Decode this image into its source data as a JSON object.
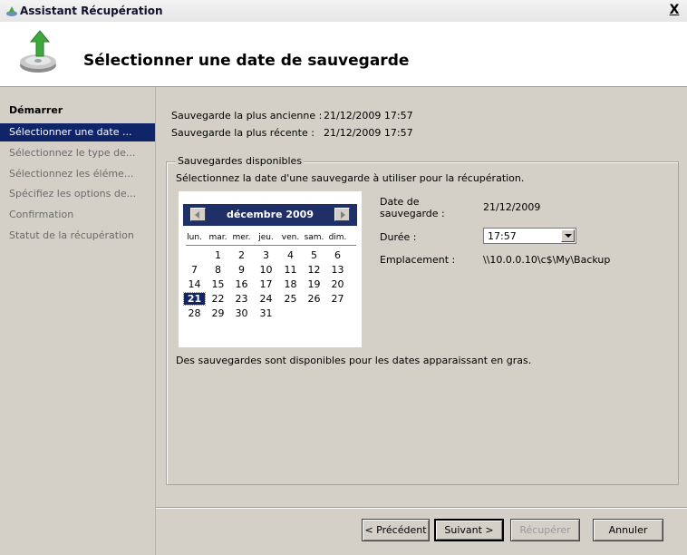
{
  "window": {
    "title": "Assistant Récupération",
    "close_glyph": "X"
  },
  "header": {
    "title": "Sélectionner une date de sauvegarde",
    "icon": "backup-restore-icon"
  },
  "sidebar": {
    "items": [
      {
        "label": "Démarrer",
        "state": "done"
      },
      {
        "label": "Sélectionner une date ...",
        "state": "active"
      },
      {
        "label": "Sélectionnez le type de...",
        "state": "pending"
      },
      {
        "label": "Sélectionnez les éléme...",
        "state": "pending"
      },
      {
        "label": "Spécifiez les options de...",
        "state": "pending"
      },
      {
        "label": "Confirmation",
        "state": "pending"
      },
      {
        "label": "Statut de la récupération",
        "state": "pending"
      }
    ]
  },
  "main": {
    "oldest_label": "Sauvegarde la plus ancienne :",
    "oldest_value": "21/12/2009 17:57",
    "newest_label": "Sauvegarde la plus récente :",
    "newest_value": "21/12/2009 17:57",
    "group_title": "Sauvegardes disponibles",
    "instruction": "Sélectionnez la date d'une sauvegarde à utiliser pour la récupération.",
    "note": "Des sauvegardes sont disponibles pour les dates apparaissant en gras."
  },
  "calendar": {
    "month": "décembre 2009",
    "weekdays": [
      "lun.",
      "mar.",
      "mer.",
      "jeu.",
      "ven.",
      "sam.",
      "dim."
    ],
    "weeks": [
      [
        "",
        "1",
        "2",
        "3",
        "4",
        "5",
        "6"
      ],
      [
        "7",
        "8",
        "9",
        "10",
        "11",
        "12",
        "13"
      ],
      [
        "14",
        "15",
        "16",
        "17",
        "18",
        "19",
        "20"
      ],
      [
        "21",
        "22",
        "23",
        "24",
        "25",
        "26",
        "27"
      ],
      [
        "28",
        "29",
        "30",
        "31",
        "",
        "",
        ""
      ]
    ],
    "selected": "21"
  },
  "details": {
    "date_label_1": "Date de",
    "date_label_2": "sauvegarde :",
    "date_value": "21/12/2009",
    "duration_label": "Durée :",
    "duration_value": "17:57",
    "location_label": "Emplacement :",
    "location_value": "\\\\10.0.0.10\\c$\\My\\Backup"
  },
  "footer": {
    "prev": "< Précédent",
    "next": "Suivant >",
    "restore": "Récupérer",
    "cancel": "Annuler"
  },
  "colors": {
    "selection": "#10246a",
    "calendar_header": "#1f2f68",
    "window_bg": "#d4d0c8"
  }
}
